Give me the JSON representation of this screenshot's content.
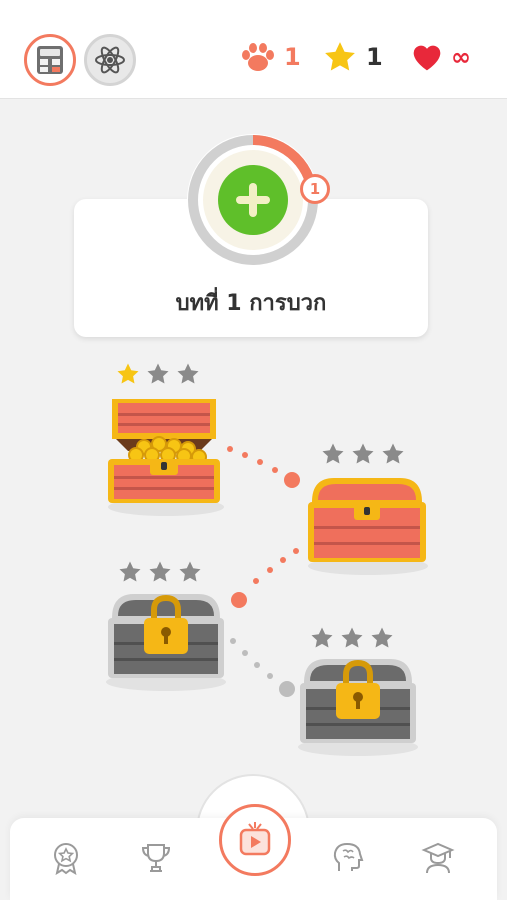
{
  "header": {
    "subjects": [
      {
        "name": "Math",
        "icon": "calculator-icon",
        "active": true
      },
      {
        "name": "Science",
        "icon": "atom-icon",
        "active": false
      }
    ],
    "stats": {
      "paws": "1",
      "stars": "1",
      "lives": "∞"
    }
  },
  "lesson": {
    "title": "บทที่ 1 การบวก",
    "progress_count": "1",
    "progress_fraction": 0.25
  },
  "chests": [
    {
      "state": "open",
      "stars_earned": 1,
      "stars_total": 3
    },
    {
      "state": "closed",
      "stars_earned": 0,
      "stars_total": 3
    },
    {
      "state": "locked",
      "stars_earned": 0,
      "stars_total": 3
    },
    {
      "state": "locked",
      "stars_earned": 0,
      "stars_total": 3
    }
  ],
  "nav": {
    "items": [
      {
        "name": "badge",
        "icon": "badge-icon"
      },
      {
        "name": "trophy",
        "icon": "trophy-icon"
      },
      {
        "name": "video",
        "icon": "play-video-icon"
      },
      {
        "name": "brain",
        "icon": "brain-icon"
      },
      {
        "name": "graduate",
        "icon": "graduate-icon"
      }
    ]
  },
  "colors": {
    "accent": "#f37a5f",
    "heart": "#e8283a",
    "star": "#f7c514",
    "green": "#5fbf2a",
    "chest_red": "#ef6f5c",
    "chest_gold": "#f5b716",
    "locked_gray": "#8a8a8a"
  }
}
